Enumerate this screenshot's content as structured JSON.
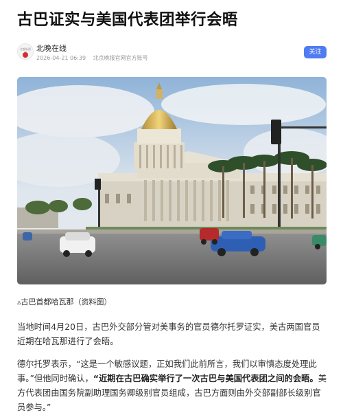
{
  "article": {
    "title": "古巴证实与美国代表团举行会晤"
  },
  "author": {
    "avatar_text": "北晚新视觉",
    "name": "北晚在线",
    "time": "2026-04-21 06:39",
    "account": "北京晚报官网官方账号",
    "follow_label": "关注"
  },
  "image": {
    "caption": "▵古巴首都哈瓦那（资料图）"
  },
  "body": {
    "p1": "当地时间4月20日，古巴外交部分管对美事务的官员德尔托罗证实，美古两国官员近期在哈瓦那进行了会晤。",
    "p2_lead": "德尔托罗表示，“这是一个敏感议题，正如我们此前所言，我们以审慎态度处理此事。”但他同时确认，",
    "p2_bold": "“近期在古巴确实举行了一次古巴与美国代表团之间的会晤。",
    "p2_tail": "美方代表团由国务院副助理国务卿级别官员组成，古巴方面则由外交部副部长级别官员参与。”"
  },
  "colors": {
    "accent": "#4f7cf0",
    "title": "#111111",
    "meta": "#999999"
  },
  "icons": {
    "avatar": "logo-avatar-icon"
  }
}
